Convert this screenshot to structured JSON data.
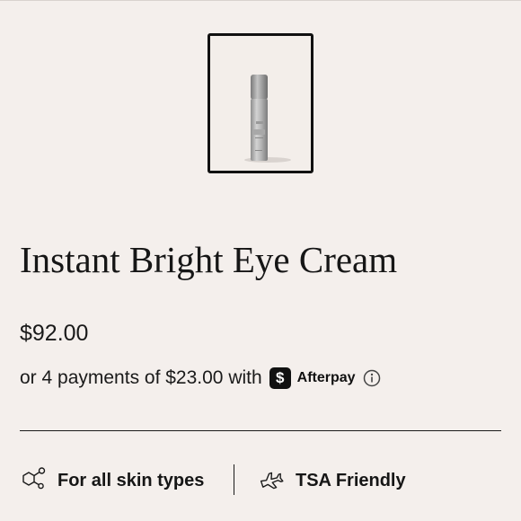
{
  "product": {
    "image_alt": "Instant Bright Eye Cream product tube",
    "title": "Instant Bright Eye Cream",
    "price": "$92.00"
  },
  "afterpay": {
    "text": "or 4 payments of $23.00 with",
    "logo_symbol": "$",
    "brand": "Afterpay",
    "icon": "info-icon"
  },
  "features": [
    {
      "icon": "molecule-icon",
      "label": "For all skin types"
    },
    {
      "icon": "airplane-icon",
      "label": "TSA Friendly"
    }
  ],
  "colors": {
    "background": "#f4efec",
    "text": "#1a1a1a",
    "thumbnail_border": "#111111"
  }
}
